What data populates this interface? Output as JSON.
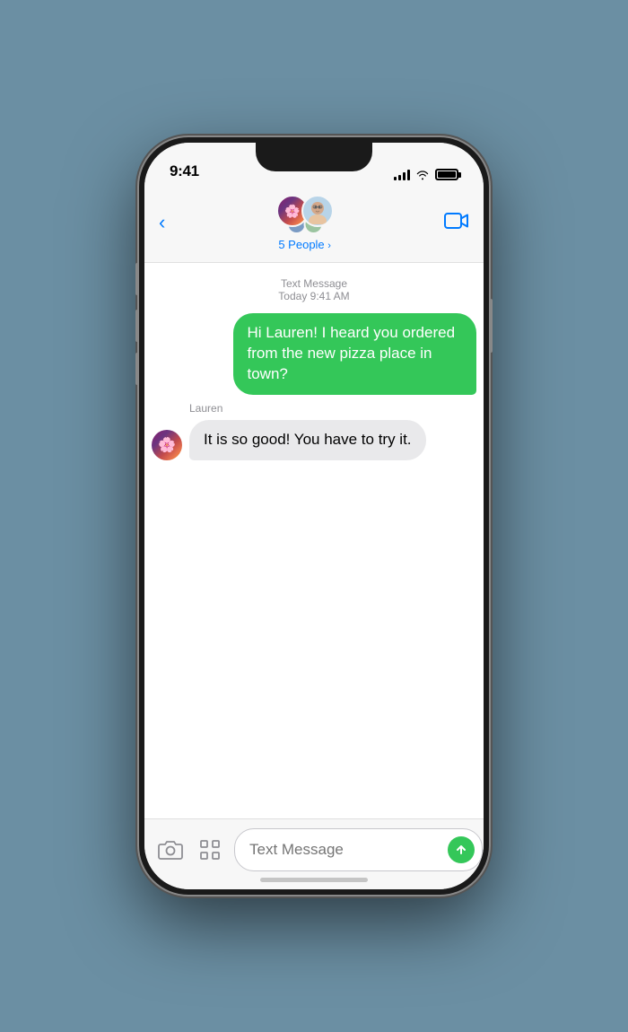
{
  "status": {
    "time": "9:41",
    "signal_label": "signal",
    "wifi_label": "wifi",
    "battery_label": "battery"
  },
  "header": {
    "back_label": "",
    "group_name": "5 People",
    "chevron": ">",
    "video_label": "video"
  },
  "messages": {
    "meta_type": "Text Message",
    "meta_time": "Today 9:41 AM",
    "outgoing_bubble": "Hi Lauren! I heard you ordered from the new pizza place in town?",
    "incoming_sender": "Lauren",
    "incoming_bubble": "It is so good! You have to try it."
  },
  "toolbar": {
    "camera_label": "camera",
    "apps_label": "apps",
    "input_placeholder": "Text Message",
    "send_label": "send"
  }
}
